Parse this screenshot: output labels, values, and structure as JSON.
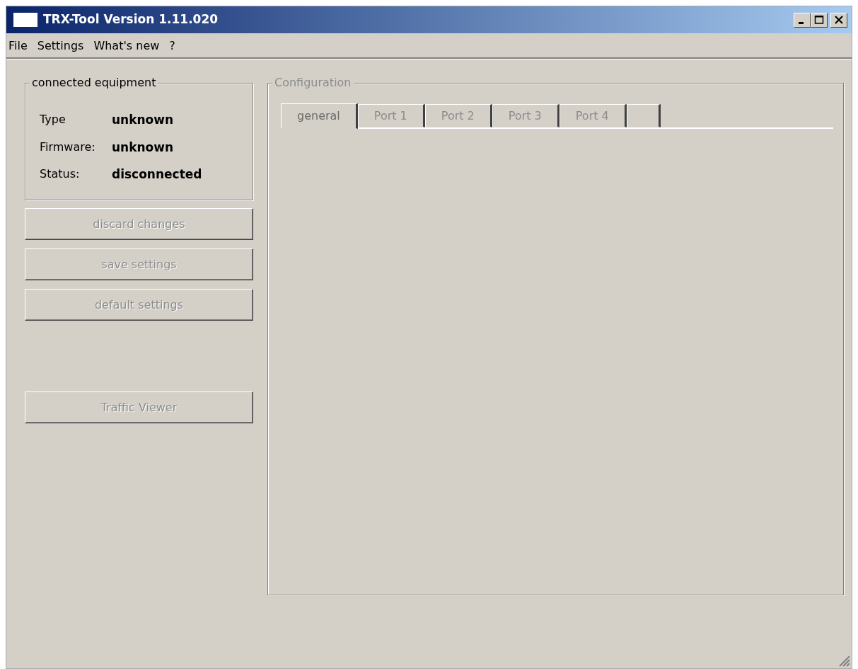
{
  "window": {
    "title": "TRX-Tool Version 1.11.020"
  },
  "menu": [
    "File",
    "Settings",
    "What's new",
    "?"
  ],
  "equipment": {
    "title": "connected equipment",
    "rows": [
      {
        "label": "Type",
        "value": "unknown"
      },
      {
        "label": "Firmware:",
        "value": "unknown"
      },
      {
        "label": "Status:",
        "value": "disconnected"
      }
    ]
  },
  "buttons": [
    {
      "label": "discard changes",
      "disabled": true
    },
    {
      "label": "save settings",
      "disabled": true
    },
    {
      "label": "default settings",
      "disabled": true
    }
  ],
  "viewer_button": {
    "label": "Traffic Viewer",
    "disabled": true
  },
  "configuration": {
    "title": "Configuration",
    "tabs": [
      {
        "label": "general",
        "selected": true
      },
      {
        "label": "Port 1",
        "selected": false
      },
      {
        "label": "Port 2",
        "selected": false
      },
      {
        "label": "Port 3",
        "selected": false
      },
      {
        "label": "Port 4",
        "selected": false
      },
      {
        "selected": false
      }
    ]
  }
}
